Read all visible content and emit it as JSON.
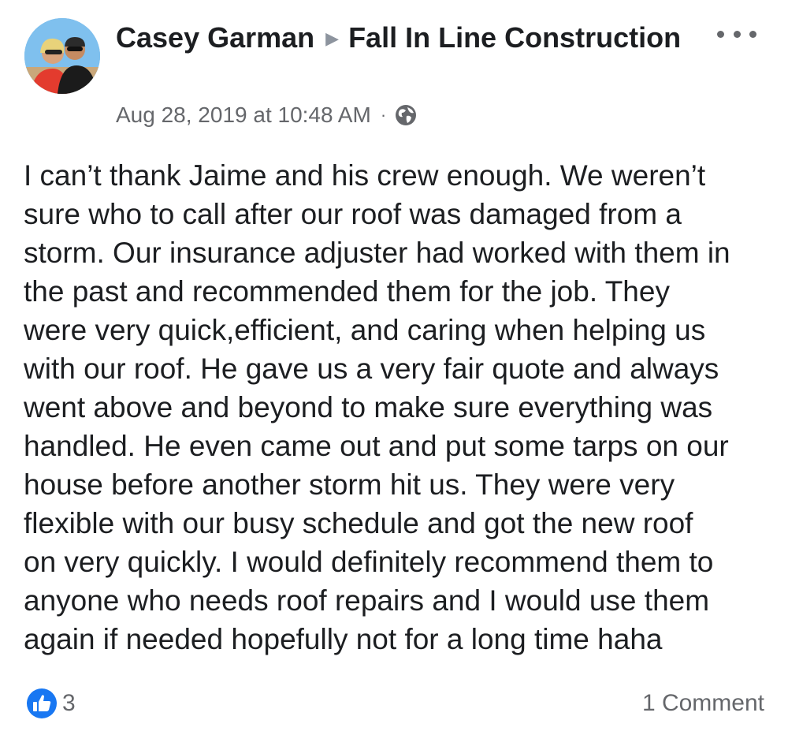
{
  "post": {
    "author": "Casey Garman",
    "target_page": "Fall In Line Construction",
    "timestamp": "Aug 28, 2019 at 10:48 AM",
    "separator": "·",
    "privacy_icon": "globe-icon",
    "more_icon": "more-options-icon",
    "text_lines": [
      "I can’t thank Jaime and his crew enough. We weren’t",
      "sure who to call after our roof was damaged from a",
      "storm. Our insurance adjuster had worked with them in",
      "the past and recommended them for the job. They",
      "were very quick,efficient, and caring when helping us",
      "with our roof. He gave us a very fair quote and always",
      "went above and beyond to make sure everything was",
      "handled. He even came out and put some tarps on our",
      "house before another storm hit us. They were very",
      "flexible with our busy schedule and got the new roof",
      "on very quickly. I would definitely recommend them to",
      "anyone who needs roof repairs and I would use them",
      "again if needed hopefully not for a long time haha"
    ]
  },
  "reactions": {
    "icon": "like-icon",
    "count": "3",
    "comments": "1 Comment"
  },
  "colors": {
    "text": "#1c1e21",
    "secondary": "#65676b",
    "like_blue": "#1877f2"
  }
}
